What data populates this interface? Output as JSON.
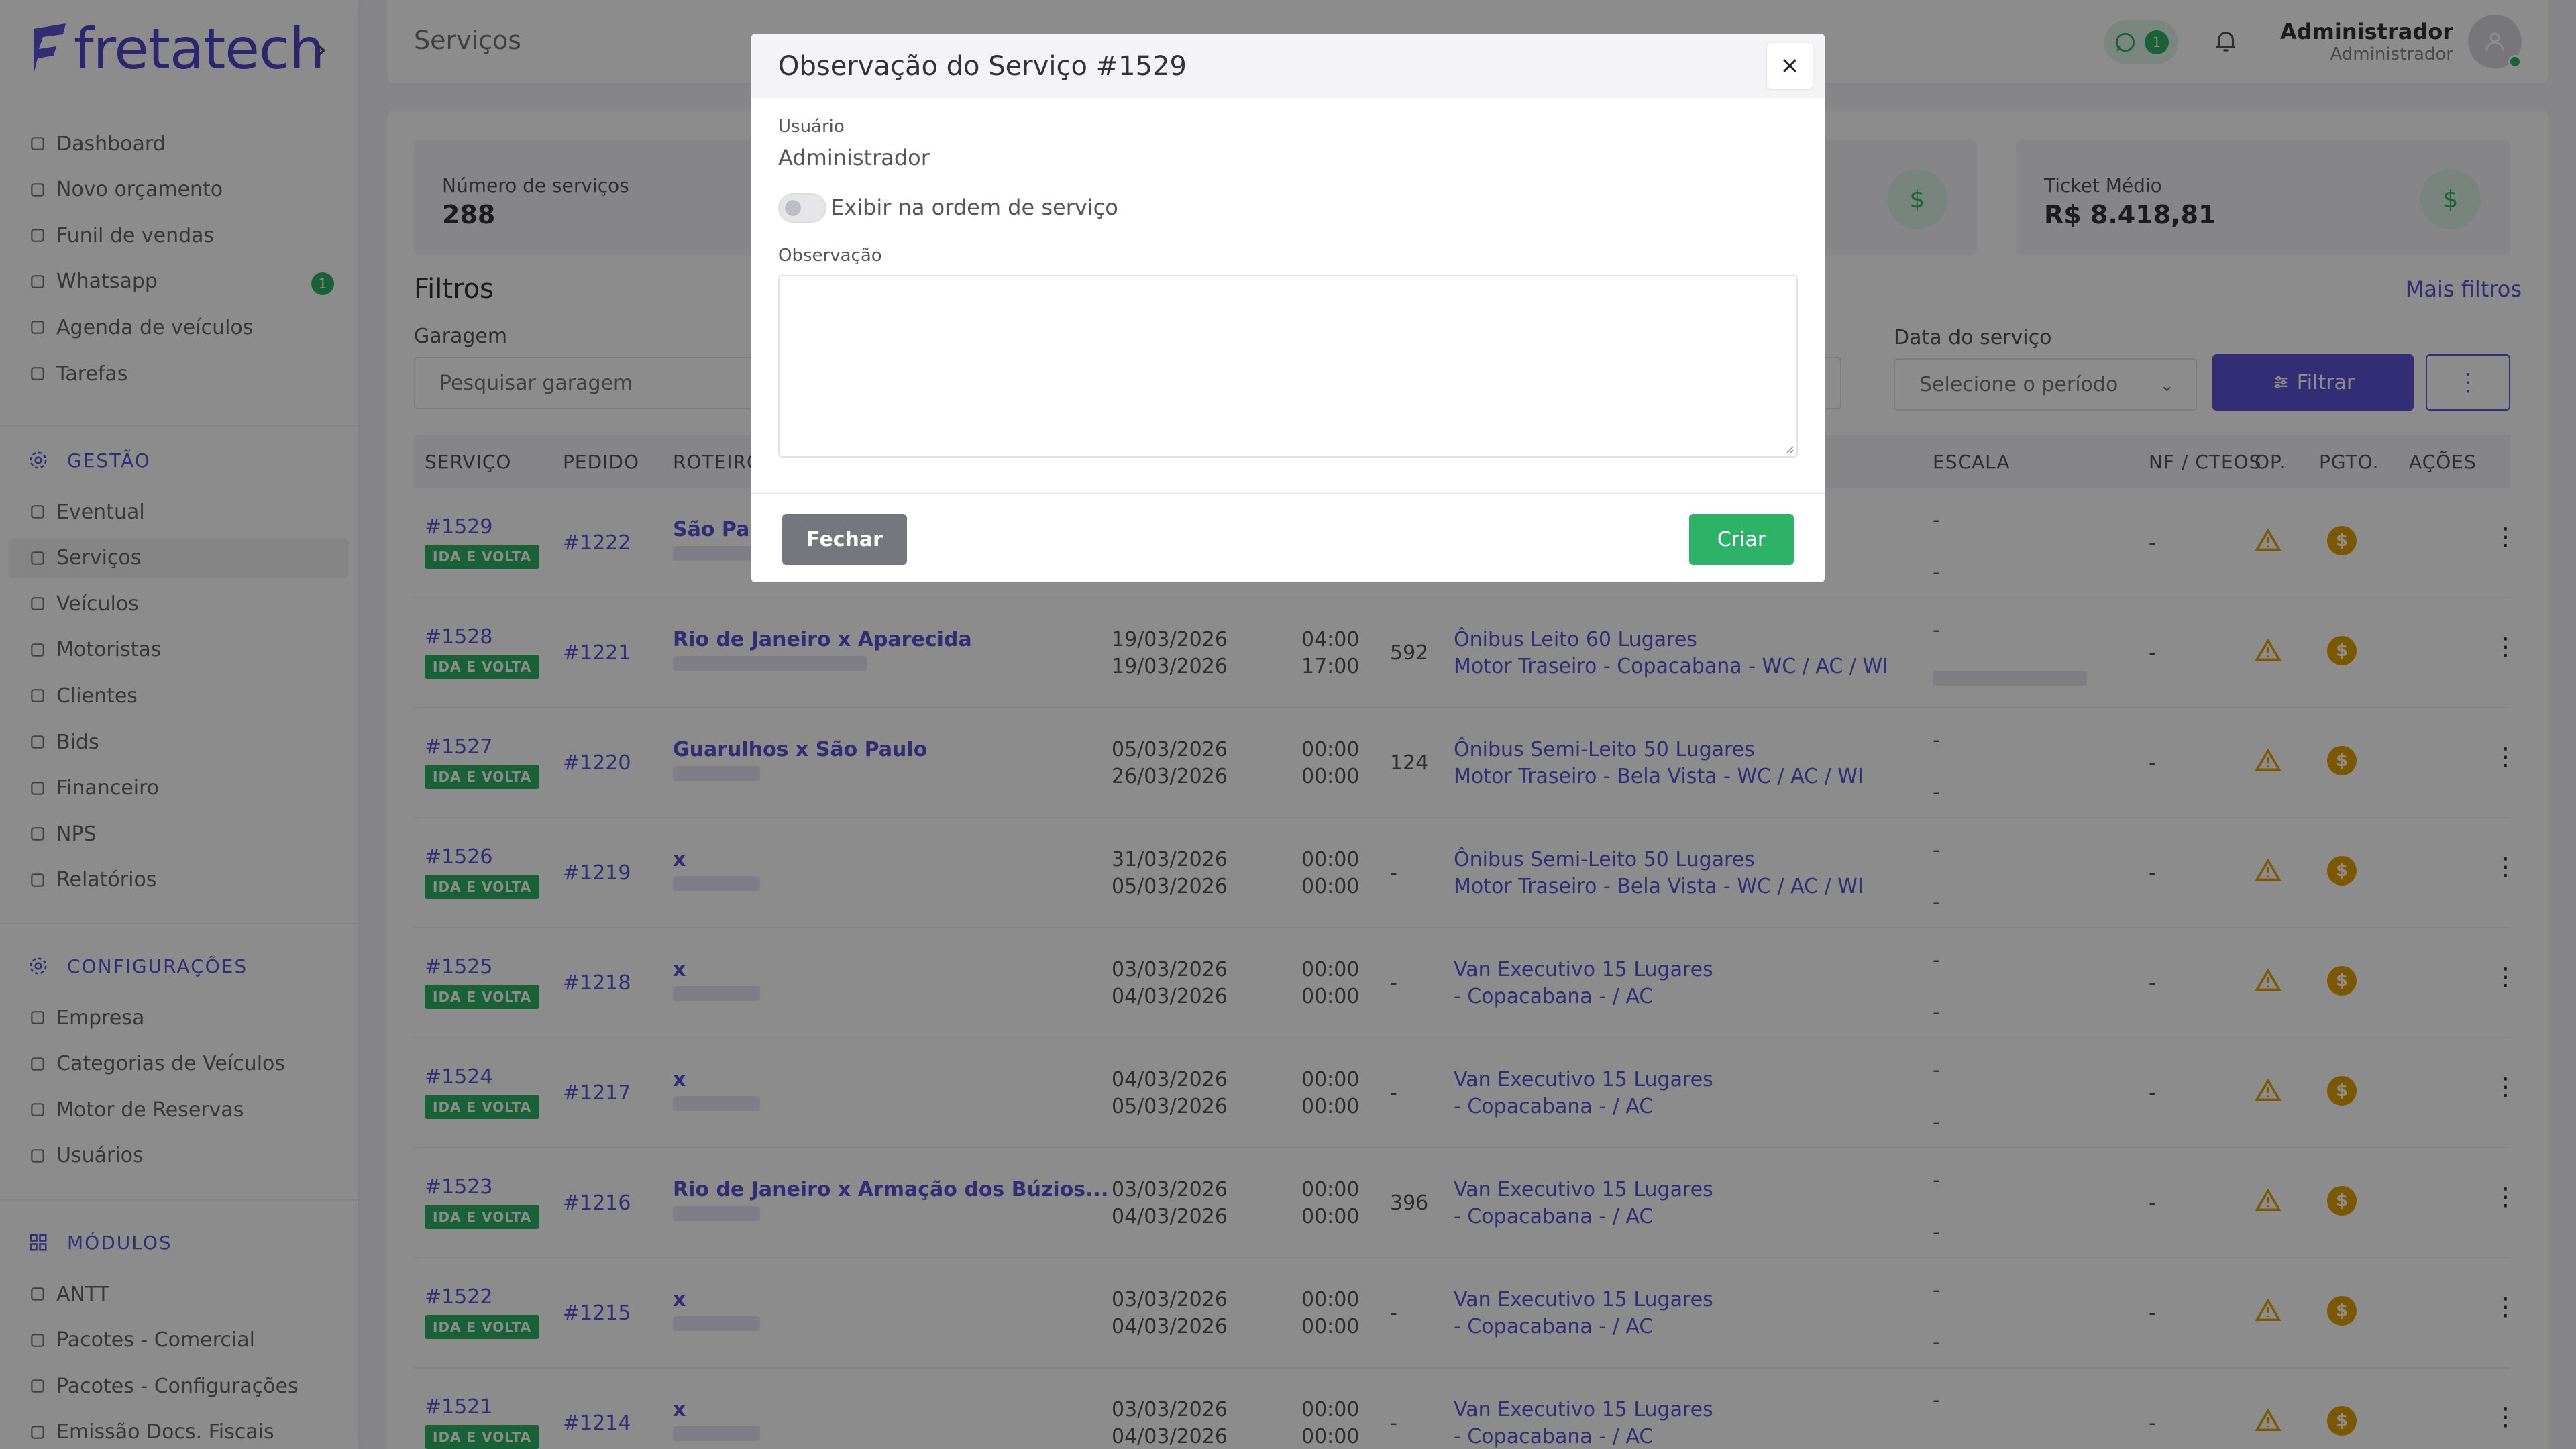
{
  "app": {
    "logo_text": "fretatech"
  },
  "sidebar": {
    "items_top": [
      {
        "label": "Dashboard",
        "icon": "home-icon"
      },
      {
        "label": "Novo orçamento",
        "icon": "edit-icon"
      },
      {
        "label": "Funil de vendas",
        "icon": "funnel-icon"
      },
      {
        "label": "Whatsapp",
        "icon": "whatsapp-icon",
        "badge": "1"
      },
      {
        "label": "Agenda de veículos",
        "icon": "calendar-icon"
      },
      {
        "label": "Tarefas",
        "icon": "list-icon"
      }
    ],
    "section_gestao": "GESTÃO",
    "items_gestao": [
      {
        "label": "Eventual",
        "icon": "file-icon"
      },
      {
        "label": "Serviços",
        "icon": "briefcase-icon",
        "active": true
      },
      {
        "label": "Veículos",
        "icon": "bus-icon"
      },
      {
        "label": "Motoristas",
        "icon": "steering-icon"
      },
      {
        "label": "Clientes",
        "icon": "users-icon"
      },
      {
        "label": "Bids",
        "icon": "gavel-icon"
      },
      {
        "label": "Financeiro",
        "icon": "dollar-icon"
      },
      {
        "label": "NPS",
        "icon": "chat-icon"
      },
      {
        "label": "Relatórios",
        "icon": "chart-icon"
      }
    ],
    "section_config": "CONFIGURAÇÕES",
    "items_config": [
      {
        "label": "Empresa",
        "icon": "building-icon"
      },
      {
        "label": "Categorias de Veículos",
        "icon": "grid-icon"
      },
      {
        "label": "Motor de Reservas",
        "icon": "table-icon"
      },
      {
        "label": "Usuários",
        "icon": "user-icon"
      }
    ],
    "section_modulos": "MÓDULOS",
    "items_modulos": [
      {
        "label": "ANTT",
        "icon": "warning-icon"
      },
      {
        "label": "Pacotes - Comercial",
        "icon": "package-icon"
      },
      {
        "label": "Pacotes - Configurações",
        "icon": "package-settings-icon"
      },
      {
        "label": "Emissão Docs. Fiscais",
        "icon": "document-icon"
      }
    ]
  },
  "header": {
    "title": "Serviços",
    "whatsapp_count": "1",
    "user_name": "Administrador",
    "user_role": "Administrador"
  },
  "stats": [
    {
      "label": "Número de serviços",
      "value": "288"
    },
    {
      "label": "Ticket Médio",
      "value": "R$ 8.418,81"
    }
  ],
  "filters": {
    "title": "Filtros",
    "more": "Mais filtros",
    "garagem_label": "Garagem",
    "garagem_placeholder": "Pesquisar garagem",
    "data_label": "Data do serviço",
    "data_placeholder": "Selecione o período",
    "filter_button": "Filtrar"
  },
  "table": {
    "headers": [
      "SERVIÇO",
      "PEDIDO",
      "ROTEIRO",
      "ESCALA",
      "NF / CTEOS",
      "OP.",
      "PGTO.",
      "AÇÕES"
    ],
    "rows": [
      {
        "id": "#1529",
        "tag": "IDA E VOLTA",
        "pedido": "#1222",
        "roteiro": "São Paulo",
        "d1": "",
        "d2": "",
        "t1": "",
        "t2": "",
        "km": "",
        "v1": "",
        "v2": "",
        "e1": "-",
        "e2": "-",
        "nf": "-"
      },
      {
        "id": "#1528",
        "tag": "IDA E VOLTA",
        "pedido": "#1221",
        "roteiro": "Rio de Janeiro x Aparecida",
        "d1": "19/03/2026",
        "d2": "19/03/2026",
        "t1": "04:00",
        "t2": "17:00",
        "km": "592",
        "v1": "Ônibus Leito 60 Lugares",
        "v2": "Motor Traseiro - Copacabana - WC / AC / WI",
        "e1": "-",
        "e2": "",
        "nf": "-"
      },
      {
        "id": "#1527",
        "tag": "IDA E VOLTA",
        "pedido": "#1220",
        "roteiro": "Guarulhos x São Paulo",
        "d1": "05/03/2026",
        "d2": "26/03/2026",
        "t1": "00:00",
        "t2": "00:00",
        "km": "124",
        "v1": "Ônibus Semi-Leito 50 Lugares",
        "v2": "Motor Traseiro - Bela Vista - WC / AC / WI",
        "e1": "-",
        "e2": "-",
        "nf": "-"
      },
      {
        "id": "#1526",
        "tag": "IDA E VOLTA",
        "pedido": "#1219",
        "roteiro": "x",
        "d1": "31/03/2026",
        "d2": "05/03/2026",
        "t1": "00:00",
        "t2": "00:00",
        "km": "-",
        "v1": "Ônibus Semi-Leito 50 Lugares",
        "v2": "Motor Traseiro - Bela Vista - WC / AC / WI",
        "e1": "-",
        "e2": "-",
        "nf": "-"
      },
      {
        "id": "#1525",
        "tag": "IDA E VOLTA",
        "pedido": "#1218",
        "roteiro": "x",
        "d1": "03/03/2026",
        "d2": "04/03/2026",
        "t1": "00:00",
        "t2": "00:00",
        "km": "-",
        "v1": "Van Executivo 15 Lugares",
        "v2": "- Copacabana - / AC",
        "e1": "-",
        "e2": "-",
        "nf": "-"
      },
      {
        "id": "#1524",
        "tag": "IDA E VOLTA",
        "pedido": "#1217",
        "roteiro": "x",
        "d1": "04/03/2026",
        "d2": "05/03/2026",
        "t1": "00:00",
        "t2": "00:00",
        "km": "-",
        "v1": "Van Executivo 15 Lugares",
        "v2": "- Copacabana - / AC",
        "e1": "-",
        "e2": "-",
        "nf": "-"
      },
      {
        "id": "#1523",
        "tag": "IDA E VOLTA",
        "pedido": "#1216",
        "roteiro": "Rio de Janeiro x Armação dos Búzios...",
        "d1": "03/03/2026",
        "d2": "04/03/2026",
        "t1": "00:00",
        "t2": "00:00",
        "km": "396",
        "v1": "Van Executivo 15 Lugares",
        "v2": "- Copacabana - / AC",
        "e1": "-",
        "e2": "-",
        "nf": "-"
      },
      {
        "id": "#1522",
        "tag": "IDA E VOLTA",
        "pedido": "#1215",
        "roteiro": "x",
        "d1": "03/03/2026",
        "d2": "04/03/2026",
        "t1": "00:00",
        "t2": "00:00",
        "km": "-",
        "v1": "Van Executivo 15 Lugares",
        "v2": "- Copacabana - / AC",
        "e1": "-",
        "e2": "-",
        "nf": "-"
      },
      {
        "id": "#1521",
        "tag": "IDA E VOLTA",
        "pedido": "#1214",
        "roteiro": "x",
        "d1": "03/03/2026",
        "d2": "04/03/2026",
        "t1": "00:00",
        "t2": "00:00",
        "km": "-",
        "v1": "Van Executivo 15 Lugares",
        "v2": "- Copacabana - / AC",
        "e1": "-",
        "e2": "-",
        "nf": "-"
      }
    ]
  },
  "modal": {
    "title": "Observação do Serviço #1529",
    "user_label": "Usuário",
    "user_value": "Administrador",
    "toggle_label": "Exibir na ordem de serviço",
    "obs_label": "Observação",
    "obs_value": "",
    "close_button": "Fechar",
    "create_button": "Criar"
  },
  "colors": {
    "accent": "#5b52d6",
    "success": "#2eb267",
    "warning": "#e0a100"
  }
}
